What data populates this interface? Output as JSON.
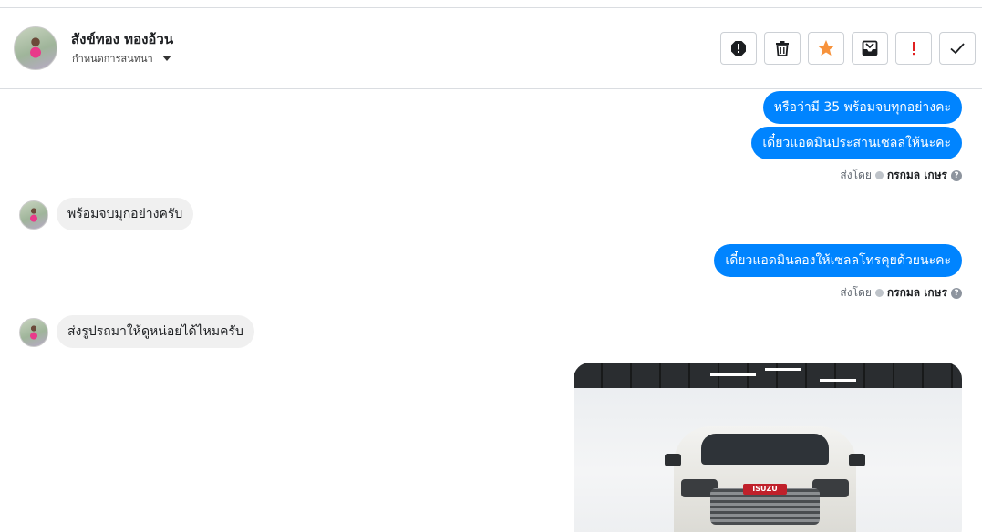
{
  "header": {
    "contact_name": "สังข์ทอง ทองอ้วน",
    "subtitle": "กำหนดการสนทนา",
    "actions": [
      {
        "name": "report-icon",
        "label": "Report"
      },
      {
        "name": "trash-icon",
        "label": "Delete"
      },
      {
        "name": "star-icon",
        "label": "Star"
      },
      {
        "name": "archive-icon",
        "label": "Archive"
      },
      {
        "name": "spam-icon",
        "label": "Spam"
      },
      {
        "name": "check-icon",
        "label": "Done"
      }
    ],
    "star_color": "#f7923b",
    "spam_color": "#e02020"
  },
  "messages": [
    {
      "dir": "out",
      "text": "หรือว่ามี 35 พร้อมจบทุกอย่างคะ"
    },
    {
      "dir": "out",
      "text": "เดี๋ยวแอดมินประสานเซลลให้นะคะ"
    },
    {
      "dir": "meta",
      "sent_by_label": "ส่งโดย",
      "sender": "กรกมล เกษร"
    },
    {
      "dir": "in",
      "text": "พร้อมจบมุกอย่างครับ"
    },
    {
      "dir": "out",
      "text": "เดี๋ยวแอดมินลองให้เซลลโทรคุยด้วยนะคะ"
    },
    {
      "dir": "meta",
      "sent_by_label": "ส่งโดย",
      "sender": "กรกมล เกษร"
    },
    {
      "dir": "in",
      "text": "ส่งรูปรถมาให้ดูหน่อยได้ไหมครับ"
    },
    {
      "dir": "out-image",
      "image": "ISUZU pickup truck front view photo"
    }
  ],
  "colors": {
    "outgoing_bubble": "#0084ff",
    "incoming_bubble": "#f0f0f0"
  },
  "car_badge": "ISUZU"
}
